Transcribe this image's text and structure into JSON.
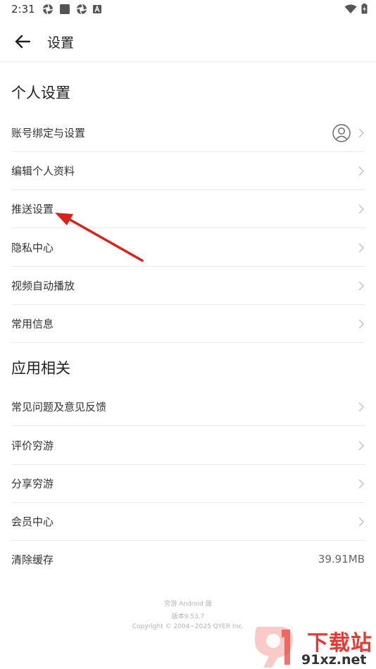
{
  "status_bar": {
    "time": "2:31"
  },
  "header": {
    "title": "设置",
    "back_icon": "arrow-left-icon"
  },
  "sections": [
    {
      "title": "个人设置",
      "items": [
        {
          "label": "账号绑定与设置",
          "icon": "avatar-icon"
        },
        {
          "label": "编辑个人资料"
        },
        {
          "label": "推送设置"
        },
        {
          "label": "隐私中心"
        },
        {
          "label": "视频自动播放"
        },
        {
          "label": "常用信息"
        }
      ]
    },
    {
      "title": "应用相关",
      "items": [
        {
          "label": "常见问题及意见反馈"
        },
        {
          "label": "评价穷游"
        },
        {
          "label": "分享穷游"
        },
        {
          "label": "会员中心"
        },
        {
          "label": "清除缓存",
          "value": "39.91MB"
        }
      ]
    }
  ],
  "footer": {
    "app_name": "穷游 Android 版",
    "version": "版本9.53.7",
    "copyright": "Copyright © 2004~2025 QYER Inc."
  },
  "watermark": {
    "brand": "下载站",
    "domain": "91xz.net"
  },
  "colors": {
    "annotation": "#d9221c",
    "divider": "#e9e9e9",
    "chevron": "#c4c4c4"
  }
}
